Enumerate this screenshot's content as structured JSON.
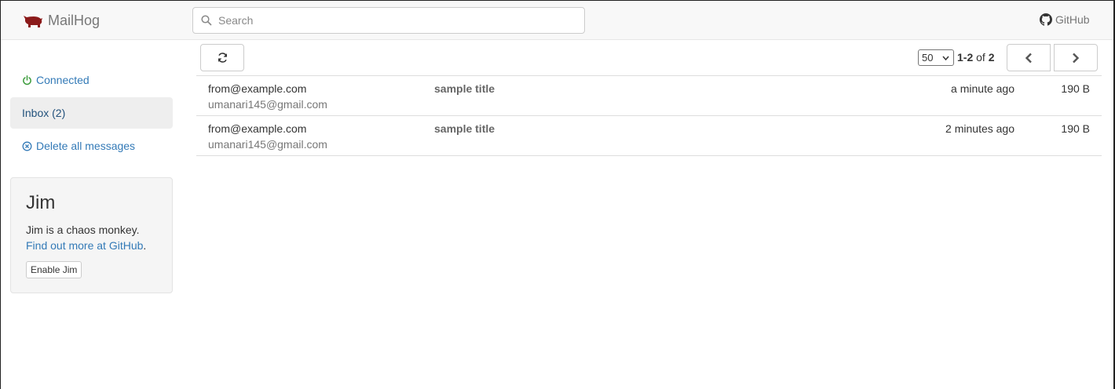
{
  "header": {
    "brand": "MailHog",
    "search_placeholder": "Search",
    "github_label": "GitHub"
  },
  "sidebar": {
    "connected_label": "Connected",
    "inbox_label": "Inbox (2)",
    "delete_label": "Delete all messages"
  },
  "jim": {
    "title": "Jim",
    "description": "Jim is a chaos monkey.",
    "link_text": "Find out more at GitHub",
    "link_suffix": ".",
    "button_label": "Enable Jim"
  },
  "toolbar": {
    "per_page_selected": "50",
    "range": "1-2",
    "of_label": "of",
    "total": "2"
  },
  "messages": [
    {
      "from": "from@example.com",
      "to": "umanari145@gmail.com",
      "subject": "sample title",
      "time": "a minute ago",
      "size": "190 B"
    },
    {
      "from": "from@example.com",
      "to": "umanari145@gmail.com",
      "subject": "sample title",
      "time": "2 minutes ago",
      "size": "190 B"
    }
  ],
  "colors": {
    "brand_icon": "#8b1a1a",
    "link": "#337ab7",
    "connected_icon": "#3c9c3c"
  },
  "icons": {
    "brand": "pig-logo-icon",
    "search": "search-icon",
    "github": "github-icon",
    "connected": "power-icon",
    "delete": "circle-x-icon",
    "refresh": "refresh-icon",
    "prev": "chevron-left-icon",
    "next": "chevron-right-icon"
  }
}
